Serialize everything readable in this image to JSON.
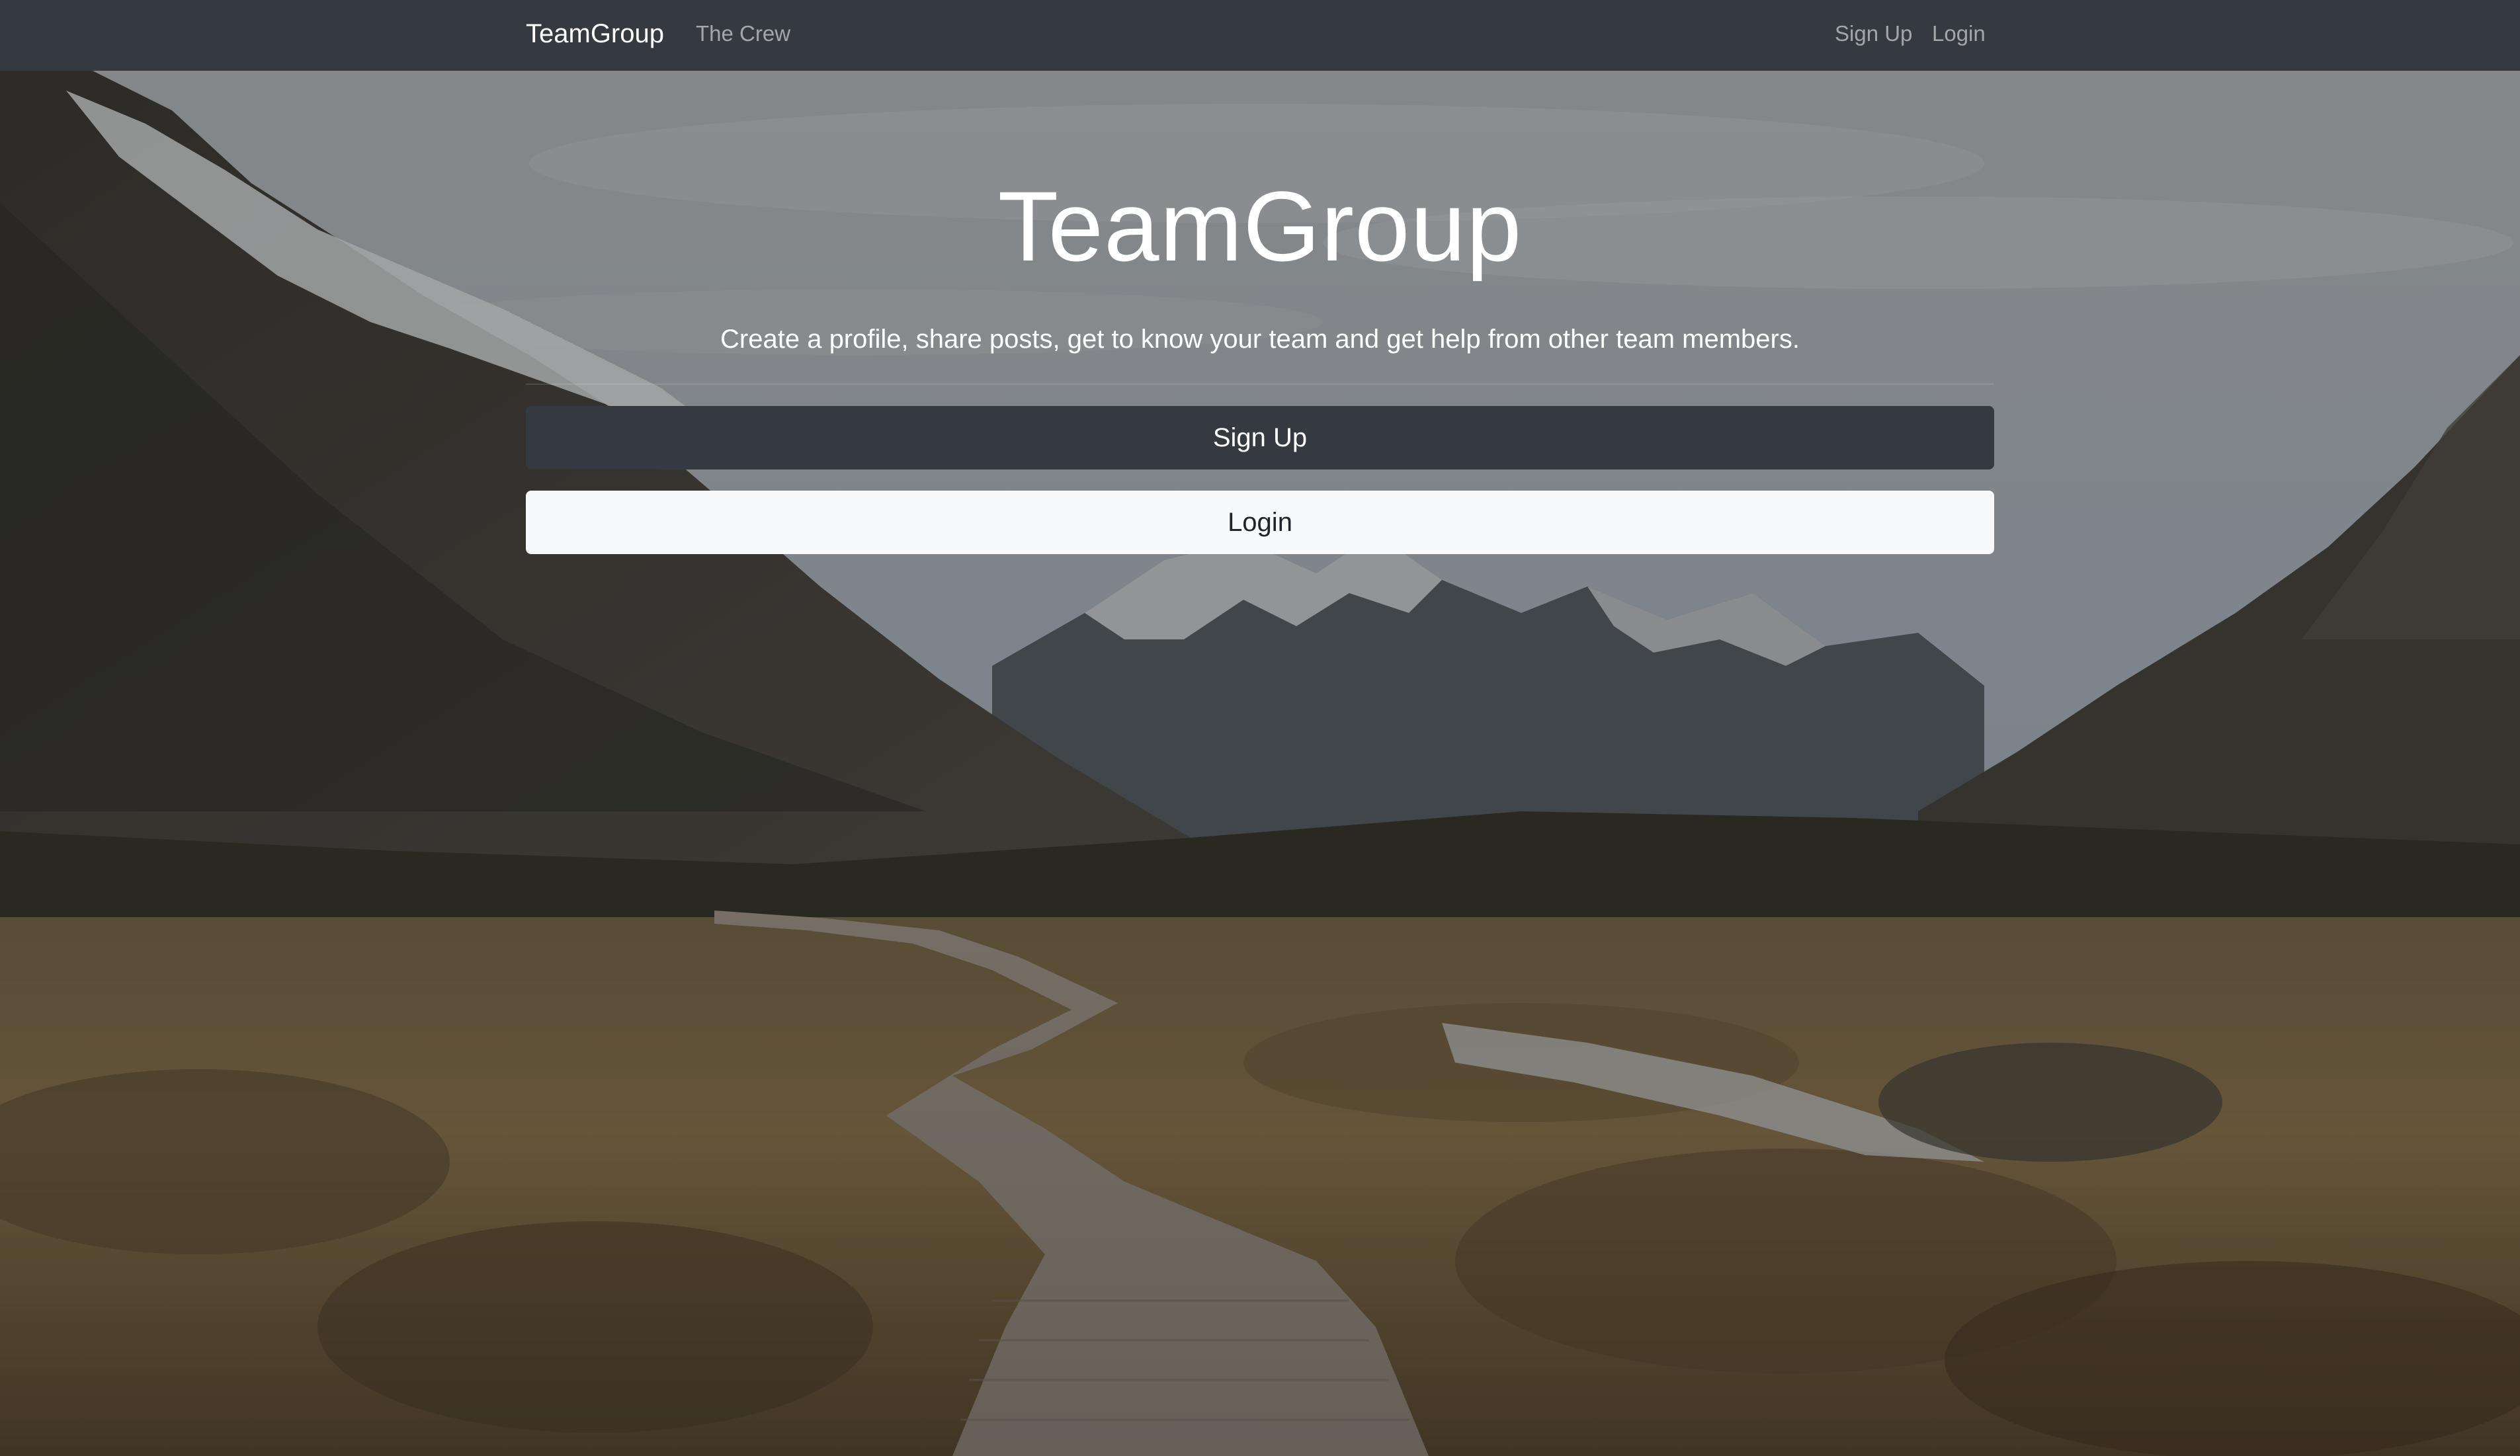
{
  "navbar": {
    "brand": "TeamGroup",
    "links": {
      "crew": "The Crew",
      "signup": "Sign Up",
      "login": "Login"
    }
  },
  "hero": {
    "title": "TeamGroup",
    "lead": "Create a profile, share posts, get to know your team and get help from other team members.",
    "buttons": {
      "signup": "Sign Up",
      "login": "Login"
    }
  },
  "colors": {
    "navbar": "#343a40",
    "signup_button": "#343a40",
    "login_button": "#f8f9fa",
    "nav_link": "rgba(255,255,255,0.55)"
  }
}
